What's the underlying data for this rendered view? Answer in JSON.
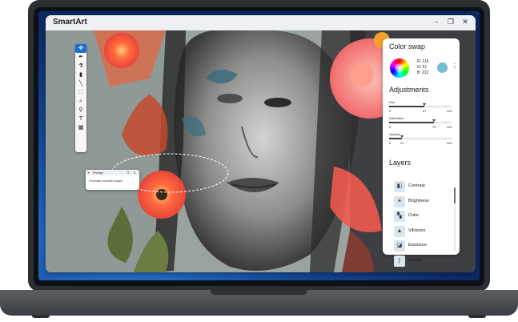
{
  "app": {
    "title": "SmartArt",
    "window_controls": [
      "–",
      "❐",
      "✕"
    ]
  },
  "toolbar": {
    "tools": [
      {
        "name": "magic-move-tool-icon",
        "glyph": "✥",
        "active": true
      },
      {
        "name": "pen-tool-icon",
        "glyph": "✒",
        "active": false
      },
      {
        "name": "brush-wand-tool-icon",
        "glyph": "⚗",
        "active": false
      },
      {
        "name": "marker-tool-icon",
        "glyph": "▮",
        "active": false
      },
      {
        "name": "line-tool-icon",
        "glyph": "╲",
        "active": false
      },
      {
        "name": "crop-tool-icon",
        "glyph": "⛶",
        "active": false
      },
      {
        "name": "zoom-tool-icon",
        "glyph": "⌕",
        "active": false
      },
      {
        "name": "dropper-tool-icon",
        "glyph": "⚲",
        "active": false
      },
      {
        "name": "text-tool-icon",
        "glyph": "T",
        "active": false
      },
      {
        "name": "grid-tool-icon",
        "glyph": "▦",
        "active": false
      }
    ]
  },
  "prompt": {
    "title": "Prompt",
    "controls": "–  ❐  ✕",
    "text": "Generate smoother edges."
  },
  "panel": {
    "color_swap": {
      "title": "Color swap",
      "r_label": "R: 116",
      "g_label": "G: 61",
      "b_label": "B: 212",
      "swatch_color": "#74bdd4",
      "more_glyph": "⋮"
    },
    "adjustments": {
      "title": "Adjustments",
      "sliders": [
        {
          "label": "Hue",
          "min": "0",
          "max": "100",
          "value": "57",
          "fraction": 0.57
        },
        {
          "label": "Saturation",
          "min": "0",
          "max": "100",
          "value": "72",
          "fraction": 0.72
        },
        {
          "label": "Opacity",
          "min": "0",
          "max": "100",
          "value": "21",
          "fraction": 0.21
        }
      ]
    },
    "layers": {
      "title": "Layers",
      "items": [
        {
          "label": "Contrast",
          "icon": "contrast-icon",
          "glyph": "◧"
        },
        {
          "label": "Brightness",
          "icon": "brightness-icon",
          "glyph": "☀"
        },
        {
          "label": "Color",
          "icon": "color-palette-icon",
          "glyph": "▚"
        },
        {
          "label": "Vibrance",
          "icon": "vibrance-icon",
          "glyph": "▲"
        },
        {
          "label": "Exposure",
          "icon": "exposure-icon",
          "glyph": "◪"
        },
        {
          "label": "Curves",
          "icon": "curves-icon",
          "glyph": "∫"
        }
      ]
    }
  }
}
